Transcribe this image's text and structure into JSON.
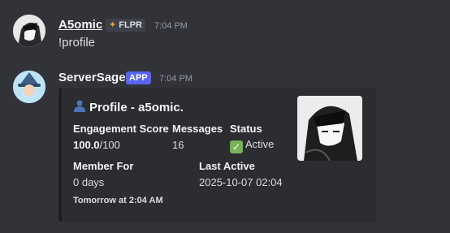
{
  "messages": [
    {
      "username": "A5omic",
      "tag": "FLPR",
      "time": "7:04 PM",
      "text": "!profile"
    },
    {
      "username": "ServerSage",
      "tag": "APP",
      "time": "7:04 PM"
    }
  ],
  "embed": {
    "title": "Profile - a5omic.",
    "fields": {
      "engagement_label": "Engagement Score",
      "engagement_value": "100.0",
      "engagement_suffix": "/100",
      "messages_label": "Messages",
      "messages_value": "16",
      "status_label": "Status",
      "status_value": "Active",
      "member_for_label": "Member For",
      "member_for_value": "0 days",
      "last_active_label": "Last Active",
      "last_active_value": "2025-10-07 02:04"
    },
    "footer": "Tomorrow at 2:04 AM"
  },
  "icons": {
    "user_icon": "bust-in-silhouette-icon",
    "status_icon": "check-mark-button-icon",
    "tag_icon": "diamond-compass-icon"
  }
}
